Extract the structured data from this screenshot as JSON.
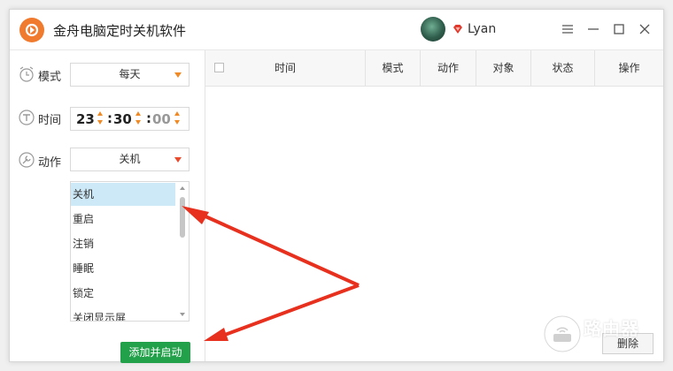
{
  "app": {
    "title": "金舟电脑定时关机软件",
    "username": "Lyan",
    "brand_color": "#f07a2e"
  },
  "form": {
    "mode_label": "模式",
    "mode_value": "每天",
    "time_label": "时间",
    "time_hour": "23",
    "time_minute": "30",
    "time_second": "00",
    "action_label": "动作",
    "action_value": "关机",
    "action_options": [
      "关机",
      "重启",
      "注销",
      "睡眠",
      "锁定",
      "关闭显示屏"
    ],
    "add_button": "添加并启动"
  },
  "table": {
    "columns": [
      "时间",
      "模式",
      "动作",
      "对象",
      "状态",
      "操作"
    ],
    "delete_button": "删除"
  },
  "watermark": {
    "text": "路由器"
  },
  "colors": {
    "accent_orange": "#f08a24",
    "add_green": "#22a04a",
    "selected_row": "#cde8f7",
    "arrow_red": "#e8301e"
  }
}
